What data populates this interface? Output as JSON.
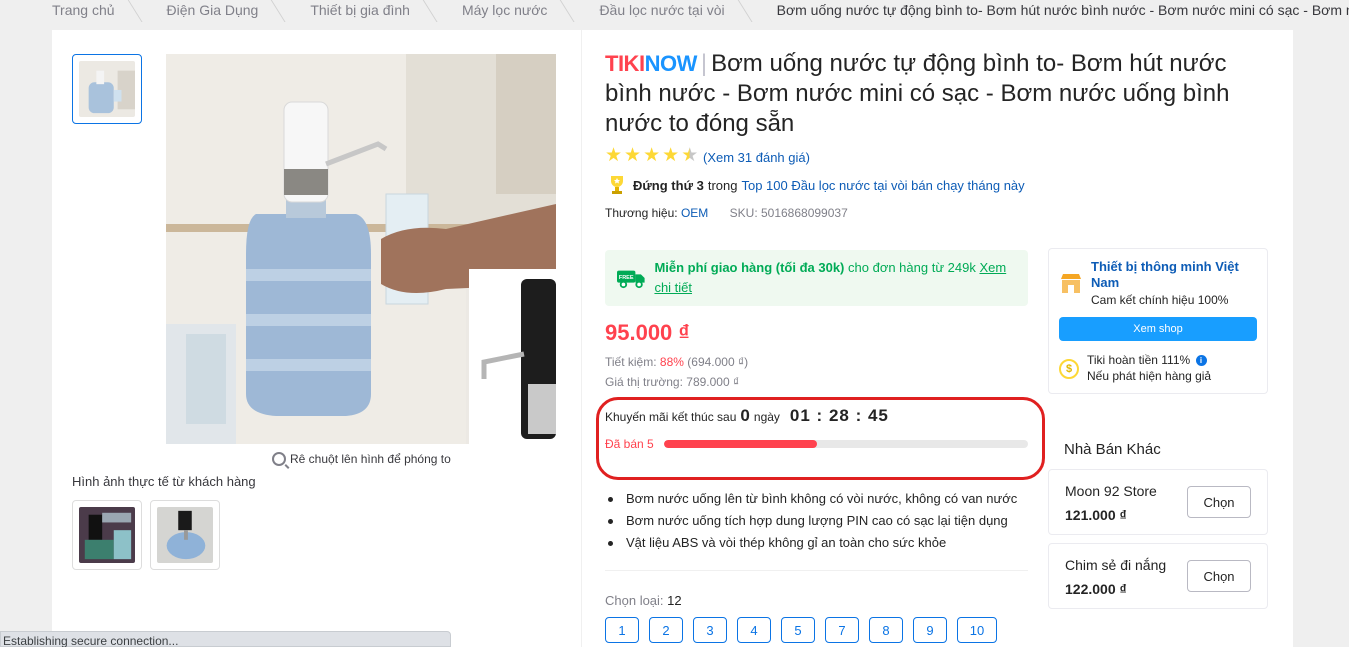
{
  "breadcrumb": [
    "Trang chủ",
    "Điện Gia Dụng",
    "Thiết bị gia đình",
    "Máy lọc nước",
    "Đầu lọc nước tại vòi",
    "Bơm uống nước tự động bình to- Bơm hút nước bình nước - Bơm nước mini có sạc - Bơm nước uống bình nước to"
  ],
  "gallery": {
    "zoom_hint": "Rê chuột lên hình để phóng to",
    "real_photos_title": "Hình ảnh thực tế từ khách hàng"
  },
  "product": {
    "brand_logo": "TIKINOW",
    "title": "Bơm uống nước tự động bình to- Bơm hút nước bình nước - Bơm nước mini có sạc - Bơm nước uống bình nước to đóng sẵn",
    "rating": 4.5,
    "reviews_link": "(Xem 31 đánh giá)",
    "rank_bold": "Đứng thứ 3",
    "rank_mid": "trong",
    "rank_link": "Top 100 Đầu lọc nước tại vòi bán chạy tháng này",
    "brand_label": "Thương hiệu:",
    "brand_value": "OEM",
    "sku": "SKU: 5016868099037"
  },
  "shipping": {
    "bold": "Miễn phí giao hàng (tối đa 30k)",
    "text": " cho đơn hàng từ 249k ",
    "link": "Xem chi tiết",
    "icon": "free-shipping-truck-icon",
    "badge": "FREE"
  },
  "pricing": {
    "price": "95.000 ₫",
    "save_label": "Tiết kiệm:",
    "save_pct": "88%",
    "save_amount": "(694.000 ₫)",
    "market": "Giá thị trường: 789.000 ₫"
  },
  "promo": {
    "label": "Khuyến mãi kết thúc sau",
    "days": "0",
    "days_unit": "ngày",
    "clock": "01 : 28 : 45",
    "sold": "Đã bán 5",
    "sold_progress": 0.42
  },
  "features": [
    "Bơm nước uống lên từ bình không có vòi nước, không có van nước",
    "Bơm nước uống tích hợp dung lượng PIN cao có sạc lại tiện dụng",
    "Vật liệu ABS và vòi thép không gỉ an toàn cho sức khỏe"
  ],
  "options": {
    "label": "Chọn loại:",
    "selected": "12",
    "values": [
      "1",
      "2",
      "3",
      "4",
      "5",
      "7",
      "8",
      "9",
      "10"
    ]
  },
  "seller": {
    "name": "Thiết bị thông minh Việt Nam",
    "sub": "Cam kết chính hiệu 100%",
    "visit": "Xem shop",
    "refund_title": "Tiki hoàn tiền 111%",
    "refund_sub": "Nếu phát hiện hàng giả",
    "info": "i",
    "refund_glyph": "$"
  },
  "other_sellers": {
    "title": "Nhà Bán Khác",
    "items": [
      {
        "name": "Moon 92 Store",
        "price": "121.000 ₫",
        "button": "Chọn"
      },
      {
        "name": "Chim sẻ đi nắng",
        "price": "122.000 ₫",
        "button": "Chọn"
      }
    ]
  },
  "status_bar": "Establishing secure connection...",
  "colors": {
    "accent": "#0b74e5",
    "price": "#ff424e",
    "ship": "#00ab56",
    "highlight": "#e02020"
  }
}
